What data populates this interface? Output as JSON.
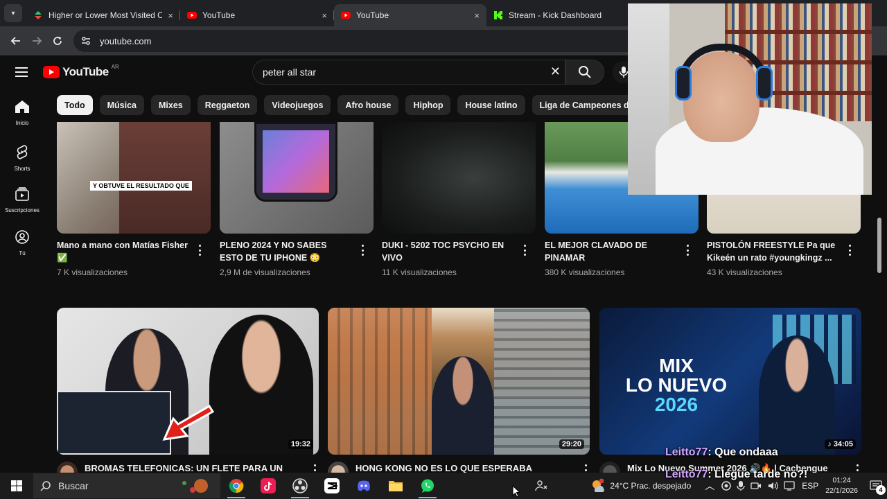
{
  "browser": {
    "tabs": [
      {
        "title": "Higher or Lower Most Visited C",
        "close": "×",
        "active": false,
        "favicon": "higher-lower-favicon"
      },
      {
        "title": "YouTube",
        "close": "×",
        "active": false,
        "favicon": "youtube-favicon"
      },
      {
        "title": "YouTube",
        "close": "×",
        "active": true,
        "favicon": "youtube-favicon"
      },
      {
        "title": "Stream - Kick Dashboard",
        "close": "",
        "active": false,
        "favicon": "kick-favicon"
      }
    ],
    "url": "youtube.com"
  },
  "header": {
    "logo_text": "YouTube",
    "country_code": "AR",
    "search_query": "peter all star",
    "search_clear": "✕"
  },
  "sidebar": {
    "items": [
      {
        "label": "Inicio",
        "icon": "home-icon"
      },
      {
        "label": "Shorts",
        "icon": "shorts-icon"
      },
      {
        "label": "Suscripciones",
        "icon": "subscriptions-icon"
      },
      {
        "label": "Tú",
        "icon": "you-icon"
      }
    ]
  },
  "chips": [
    "Todo",
    "Música",
    "Mixes",
    "Reggaeton",
    "Videojuegos",
    "Afro house",
    "Hiphop",
    "House latino",
    "Liga de Campeones de la UEFA"
  ],
  "row1": [
    {
      "title": "Mano a mano con Matías Fisher ✅",
      "meta": "7 K visualizaciones",
      "thumb_text": "Y OBTUVE EL RESULTADO QUE"
    },
    {
      "title": "PLENO 2024 Y NO SABES ESTO DE TU IPHONE 😳",
      "meta": "2,9 M de visualizaciones"
    },
    {
      "title": "DUKI - 5202 TOC PSYCHO EN VIVO",
      "meta": "11 K visualizaciones"
    },
    {
      "title": "EL MEJOR CLAVADO DE PINAMAR",
      "meta": "380 K visualizaciones"
    },
    {
      "title": "PISTOLÓN FREESTYLE Pa que Kikeén un rato #youngkingz ...",
      "meta": "43 K visualizaciones"
    }
  ],
  "row2": [
    {
      "title": "BROMAS TELEFONICAS: UN FLETE PARA UN",
      "duration": "19:32"
    },
    {
      "title": "HONG KONG NO ES LO QUE ESPERABA",
      "duration": "29:20"
    },
    {
      "title": "Mix Lo Nuevo Summer 2026 🔊🔥 | Cachengue",
      "duration": "♪ 34:05",
      "thumb_lines": [
        "MIX",
        "LO NUEVO",
        "2026"
      ]
    }
  ],
  "chat": [
    {
      "user": "Leitto77",
      "message": ": Que ondaaa"
    },
    {
      "user": "Leitto77",
      "message": ": Llegue tarde no?!"
    }
  ],
  "taskbar": {
    "search_placeholder": "Buscar",
    "weather": "24°C  Prac. despejado",
    "language": "ESP",
    "time": "01:24",
    "date": "22/1/2026",
    "notification_count": "4"
  },
  "colors": {
    "youtube_red": "#ff0000",
    "kick_green": "#53fc18",
    "chat_username": "#d5a6ff"
  }
}
